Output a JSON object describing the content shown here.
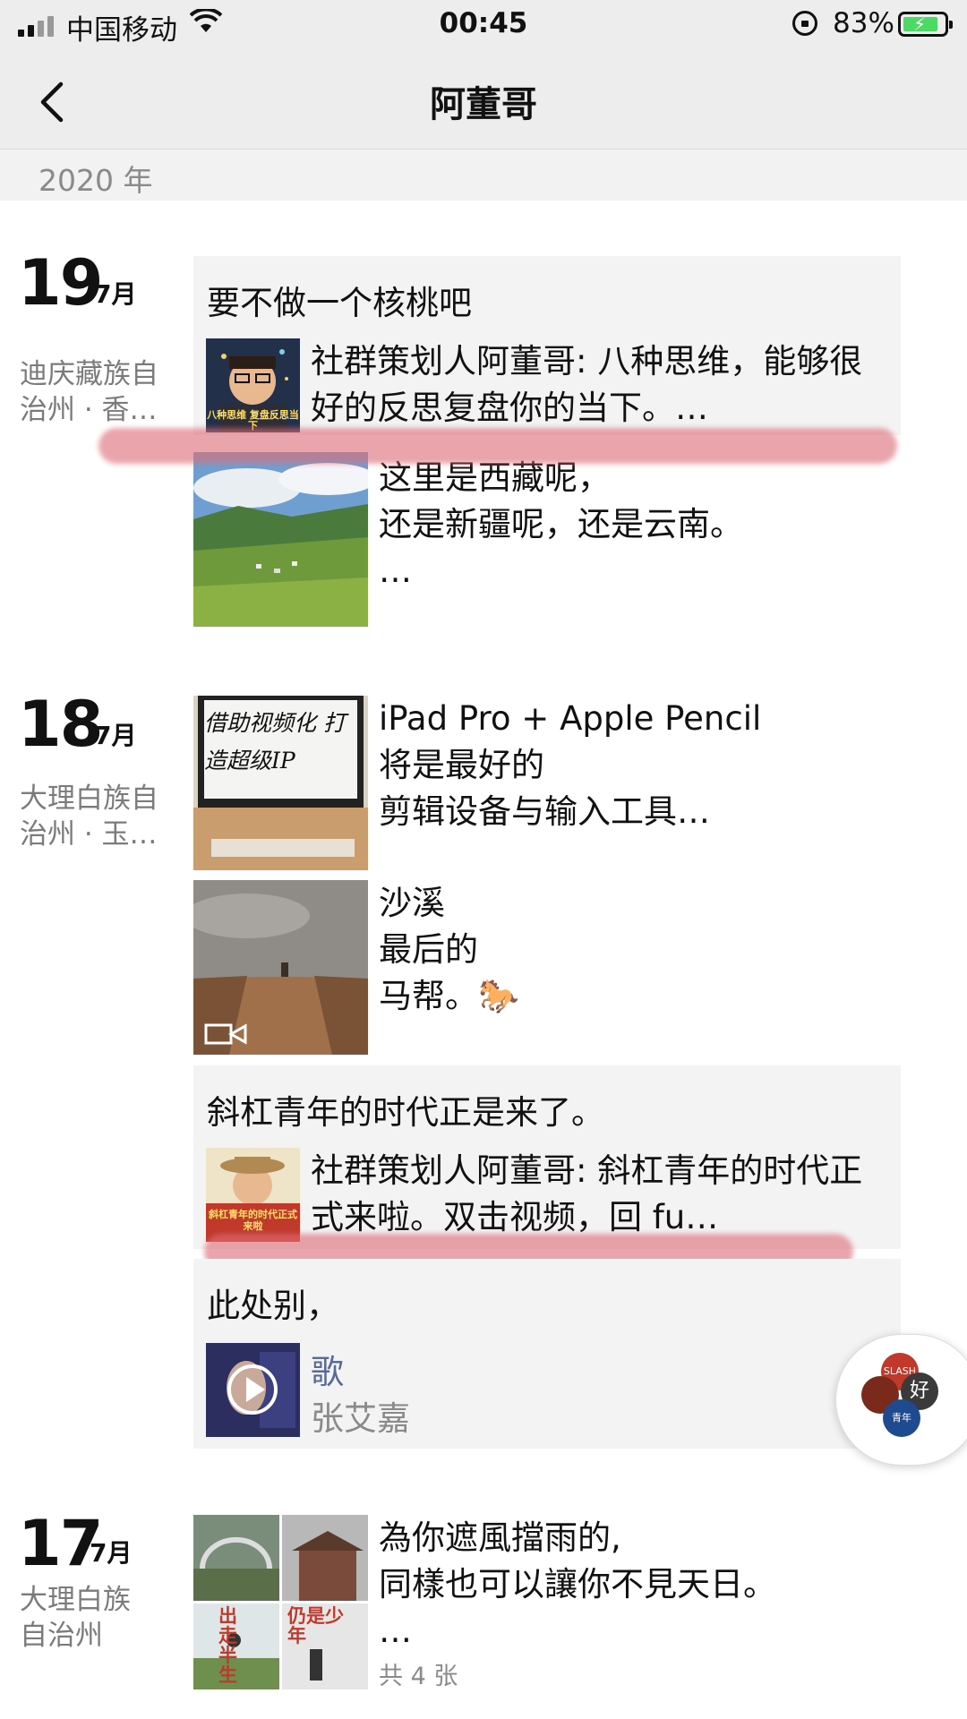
{
  "status": {
    "carrier": "中国移动",
    "time": "00:45",
    "battery_percent": "83%",
    "battery_level": 0.83,
    "battery_color": "#4cd964"
  },
  "nav": {
    "title": "阿董哥",
    "back_icon": "chevron-left-icon"
  },
  "year": "2020 年",
  "days": [
    {
      "day": "19",
      "month": "7月",
      "location": "迪庆藏族自治州 · 香…"
    },
    {
      "day": "18",
      "month": "7月",
      "location": "大理白族自治州 · 玉…"
    },
    {
      "day": "17",
      "month": "7月",
      "location": "大理白族自治州"
    }
  ],
  "posts": {
    "p19a": {
      "text": "要不做一个核桃吧",
      "link_text": "社群策划人阿董哥: 八种思维，能够很好的反思复盘你的当下。…",
      "thumb_caption": "八种思维 复盘反思当下"
    },
    "p19b": {
      "text": "这里是西藏呢，\n还是新疆呢，还是云南。\n…"
    },
    "p18a": {
      "text": "iPad Pro + Apple Pencil\n将是最好的\n剪辑设备与输入工具…",
      "thumb_caption": "借助视频化 打造超级IP"
    },
    "p18b": {
      "text": "沙溪\n最后的\n马帮。🐎"
    },
    "p18c": {
      "text": "斜杠青年的时代正是来了。",
      "link_text": "社群策划人阿董哥: 斜杠青年的时代正式来啦。双击视频，回 fu…",
      "thumb_caption": "斜杠青年的时代正式来啦"
    },
    "p18d": {
      "text": "此处别，",
      "music_title": "歌",
      "music_artist": "张艾嘉"
    },
    "p17a": {
      "text": "為你遮風擋雨的,\n同樣也可以讓你不見天日。\n…",
      "count": "共 4 张",
      "thumb_captions": [
        "出走半生",
        "仍是少年"
      ]
    }
  },
  "floating": {
    "labels": [
      "SLASH",
      "好",
      "青年"
    ]
  }
}
